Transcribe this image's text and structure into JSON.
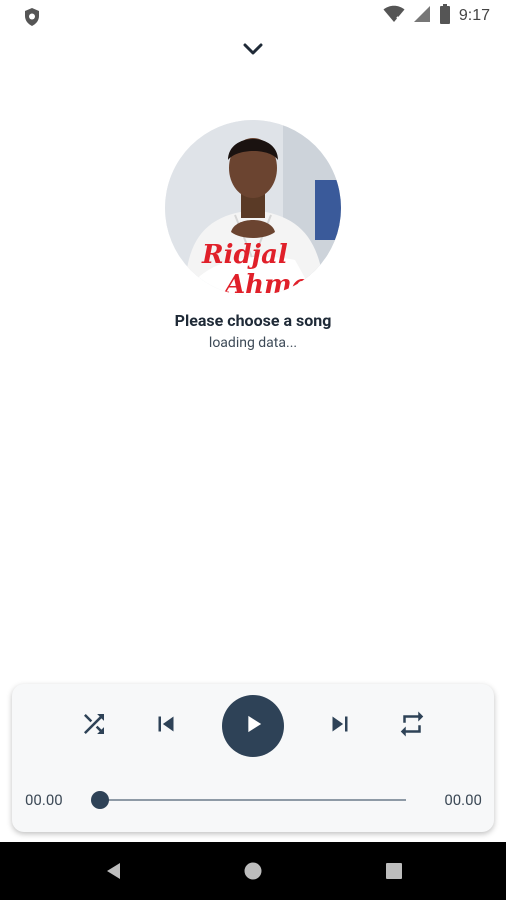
{
  "status_bar": {
    "time": "9:17"
  },
  "now_playing": {
    "title": "Please choose a song",
    "subtitle": "loading data...",
    "album_art_text": [
      "Ridjal",
      "Ahmad"
    ]
  },
  "player": {
    "current_time": "00.00",
    "duration": "00.00",
    "progress": 0,
    "accent_color": "#2e4257"
  },
  "icons": [
    "shield-icon",
    "wifi-icon",
    "signal-icon",
    "battery-icon",
    "chevron-down-icon",
    "shuffle-icon",
    "skip-previous-icon",
    "play-icon",
    "skip-next-icon",
    "repeat-icon",
    "back-icon",
    "home-icon",
    "recents-icon"
  ]
}
